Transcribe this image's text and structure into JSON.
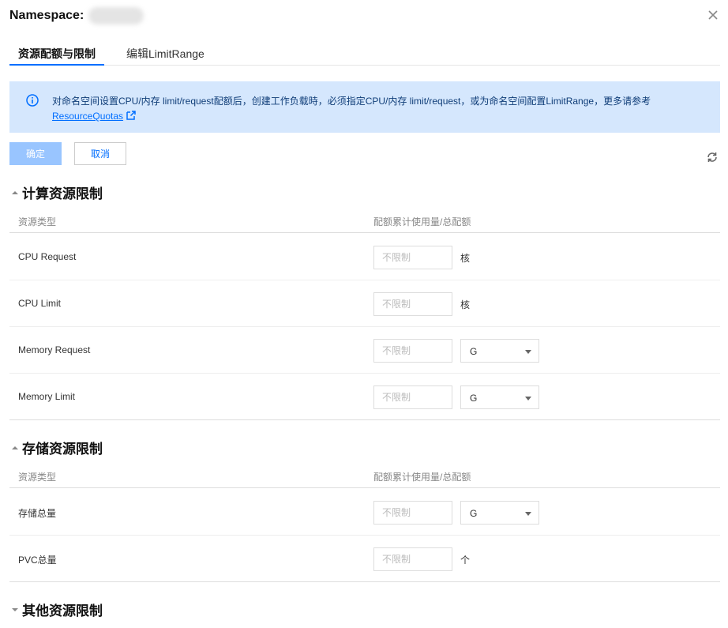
{
  "header": {
    "title": "Namespace:"
  },
  "tabs": [
    {
      "label": "资源配额与限制"
    },
    {
      "label": "编辑LimitRange"
    }
  ],
  "notice": {
    "text": "对命名空间设置CPU/内存 limit/request配额后，创建工作负载時，必须指定CPU/内存 limit/request，或为命名空间配置LimitRange，更多请参考",
    "link": "ResourceQuotas"
  },
  "actions": {
    "ok": "确定",
    "cancel": "取消"
  },
  "compute": {
    "title": "计算资源限制",
    "col_type": "资源类型",
    "col_quota": "配额累计使用量/总配额",
    "rows": [
      {
        "name": "CPU Request",
        "placeholder": "不限制",
        "unit": "核"
      },
      {
        "name": "CPU Limit",
        "placeholder": "不限制",
        "unit": "核"
      },
      {
        "name": "Memory Request",
        "placeholder": "不限制",
        "unit": "G"
      },
      {
        "name": "Memory Limit",
        "placeholder": "不限制",
        "unit": "G"
      }
    ]
  },
  "storage": {
    "title": "存储资源限制",
    "col_type": "资源类型",
    "col_quota": "配额累计使用量/总配额",
    "rows": [
      {
        "name": "存储总量",
        "placeholder": "不限制",
        "unit": "G"
      },
      {
        "name": "PVC总量",
        "placeholder": "不限制",
        "unit": "个"
      }
    ]
  },
  "other": {
    "title": "其他资源限制"
  },
  "colors": {
    "primary": "#006eff",
    "notice_bg": "#d5e7fd",
    "disabled_btn": "#99c5ff"
  },
  "icons": [
    "close-icon",
    "info-icon",
    "external-link-icon",
    "refresh-icon",
    "caret-up-icon",
    "caret-down-icon",
    "select-arrow-icon"
  ]
}
